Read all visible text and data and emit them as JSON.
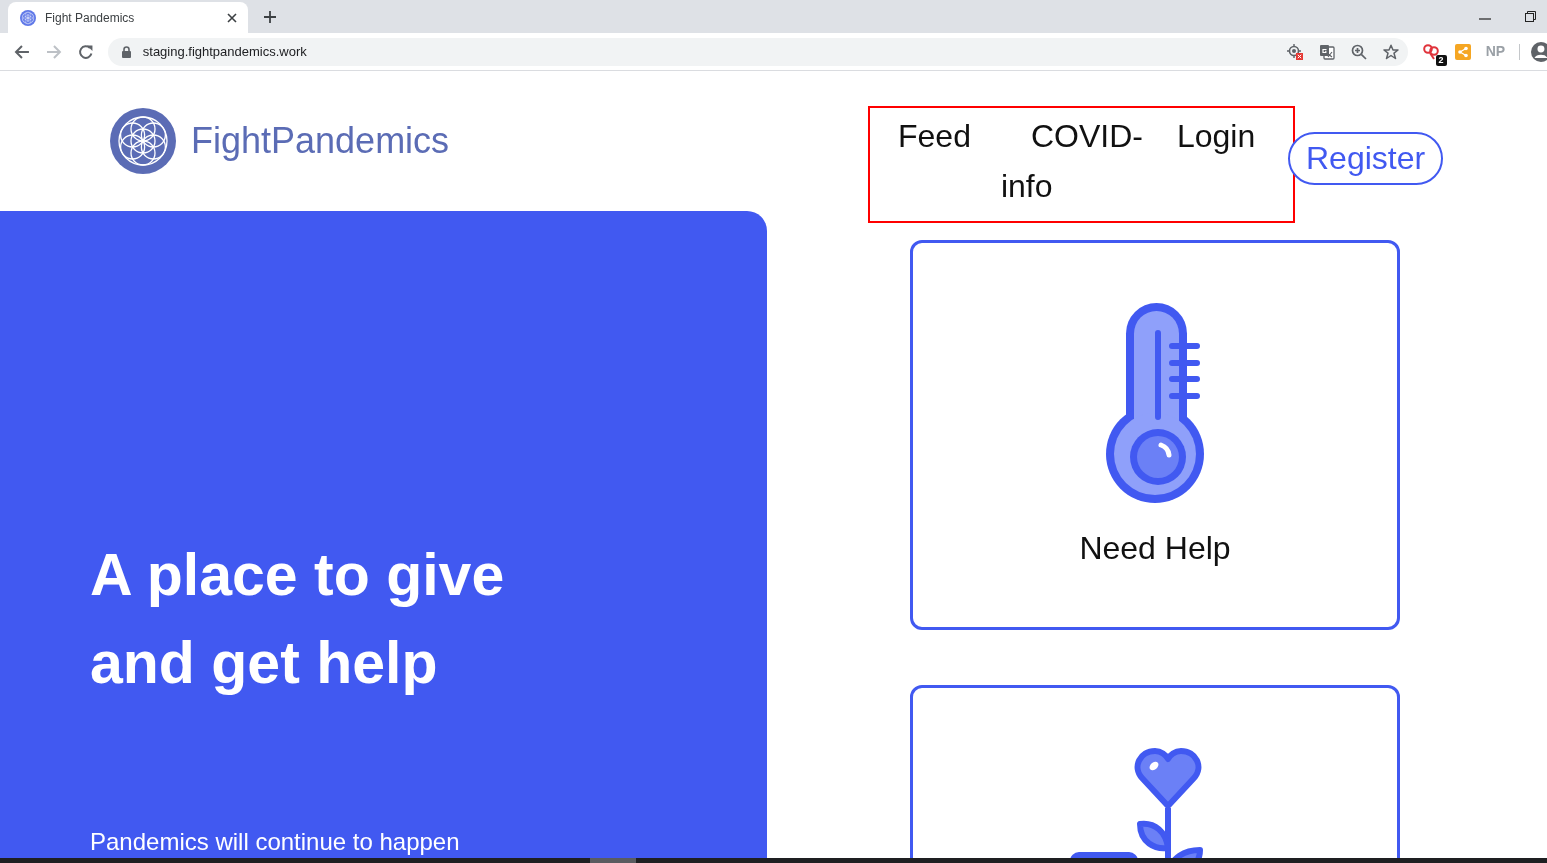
{
  "browser": {
    "tabs": [
      {
        "title": "Fight Pandemics",
        "selected": true
      }
    ],
    "forward_disabled": true,
    "url": "staging.fightpandemics.work",
    "extension_badge": "2",
    "extension_label": "NP"
  },
  "header": {
    "logo_text": "FightPandemics",
    "nav": {
      "highlighted": true,
      "links": [
        "Feed",
        "COVID-info",
        "Login"
      ]
    },
    "register_button": "Register"
  },
  "hero": {
    "heading": "A place to give and get help",
    "text": "Pandemics will continue to happen"
  },
  "cards": [
    {
      "kind": "thermometer",
      "label": "Need Help"
    },
    {
      "kind": "flower"
    }
  ]
}
